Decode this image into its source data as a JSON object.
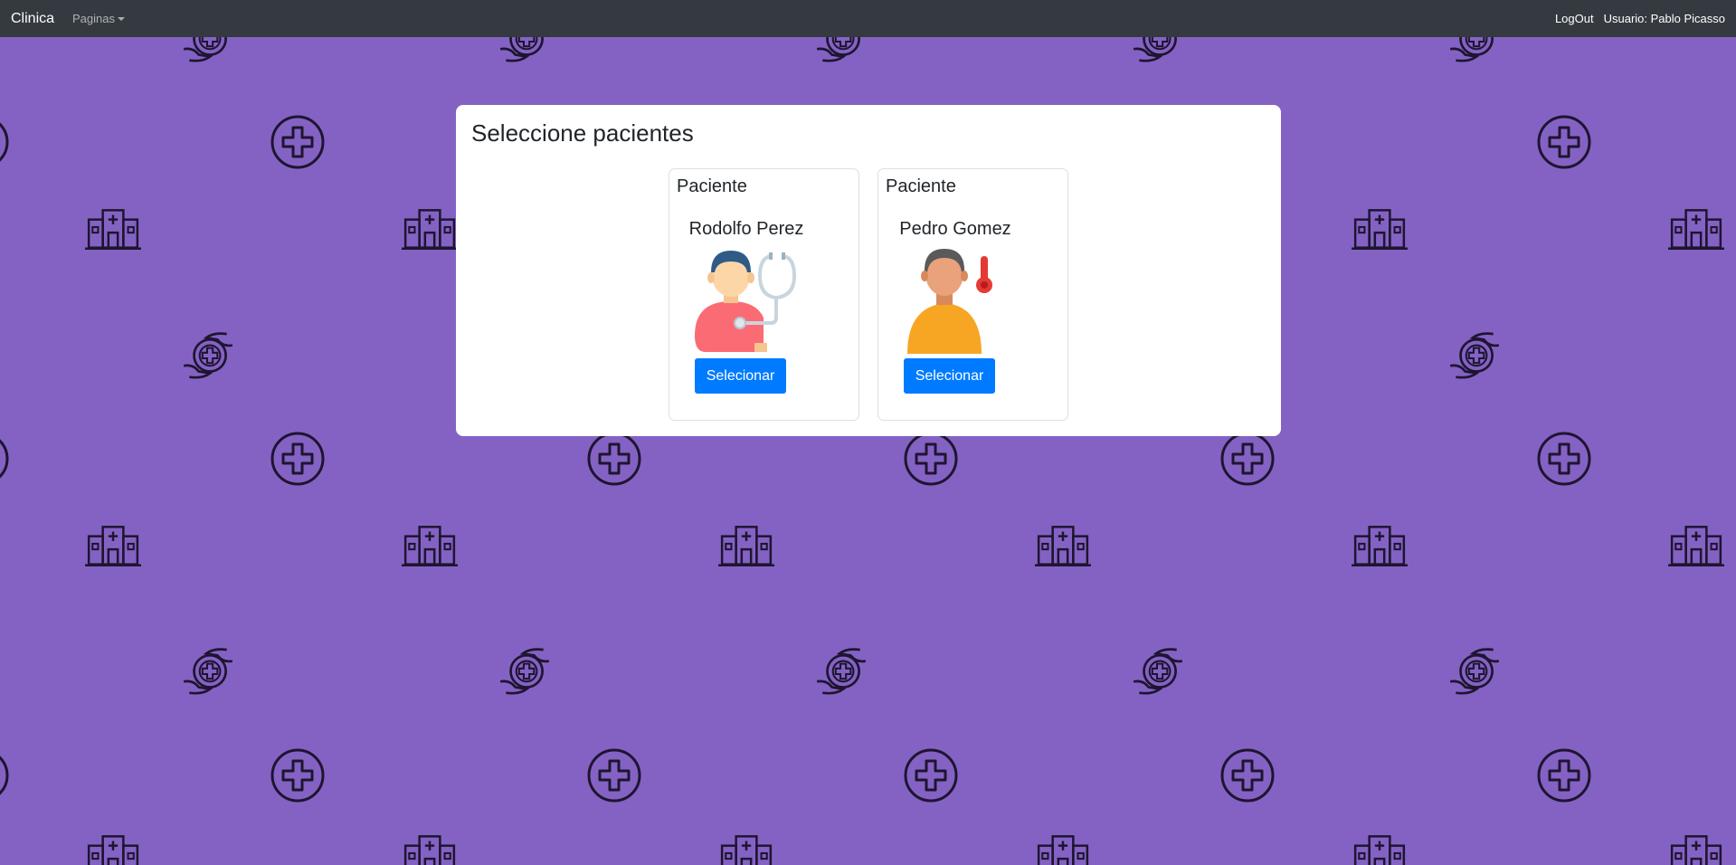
{
  "navbar": {
    "brand": "Clinica",
    "pages_menu": "Paginas",
    "logout": "LogOut",
    "user_label": "Usuario: Pablo Picasso"
  },
  "dialog": {
    "title": "Seleccione pacientes"
  },
  "patients": [
    {
      "header": "Paciente",
      "name": "Rodolfo Perez",
      "button": "Selecionar",
      "avatar_icon": "doctor-stethoscope-icon"
    },
    {
      "header": "Paciente",
      "name": "Pedro Gomez",
      "button": "Selecionar",
      "avatar_icon": "patient-thermometer-icon"
    }
  ],
  "colors": {
    "background": "#8462c4",
    "navbar": "#343a40",
    "button": "#007bff",
    "pattern": "#1e1530"
  },
  "background_pattern_icons": [
    "plus-circle-icon",
    "hospital-building-icon",
    "hands-care-icon"
  ]
}
